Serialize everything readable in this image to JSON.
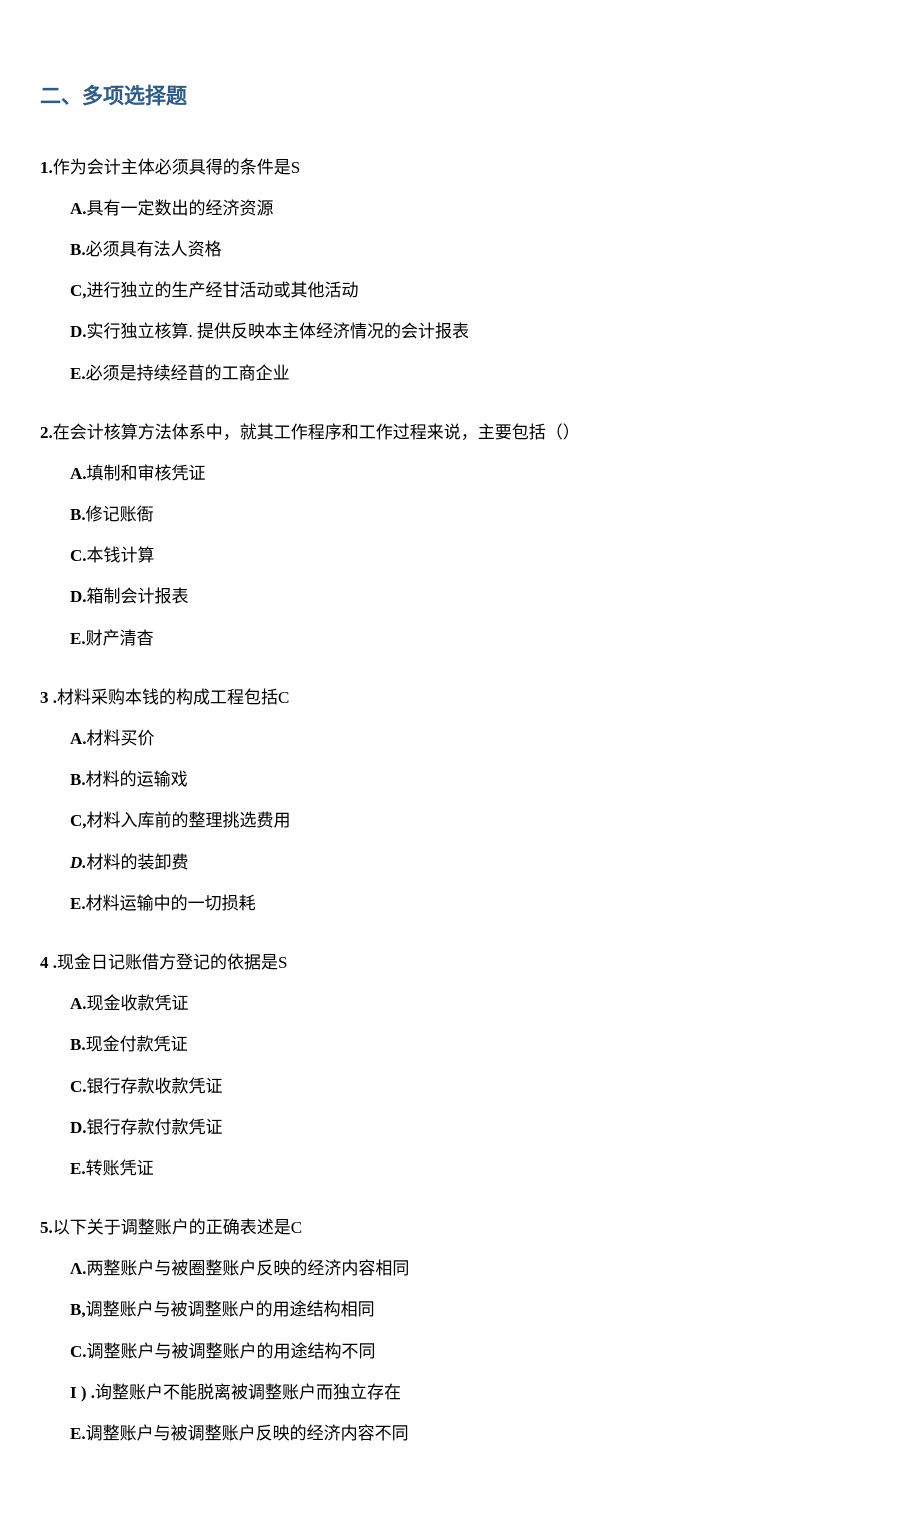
{
  "sectionTitle": "二、多项选择题",
  "questions": [
    {
      "number": "1.",
      "text": "作为会计主体必须具得的条件是S",
      "options": [
        {
          "label": "A.",
          "text": "具有一定数出的经济资源"
        },
        {
          "label": "B.",
          "text": "必须具有法人资格"
        },
        {
          "label": "C,",
          "text": "进行独立的生产经甘活动或其他活动"
        },
        {
          "label": "D.",
          "text": "实行独立核算. 提供反映本主体经济情况的会计报表"
        },
        {
          "label": "E.",
          "text": "必须是持续经苜的工商企业"
        }
      ]
    },
    {
      "number": "2.",
      "text": "在会计核算方法体系中，就其工作程序和工作过程来说，主要包括（）",
      "options": [
        {
          "label": "A.",
          "text": "填制和审核凭证"
        },
        {
          "label": "B.",
          "text": "修记账衙"
        },
        {
          "label": "C.",
          "text": "本钱计算"
        },
        {
          "label": "D.",
          "text": "箱制会计报表"
        },
        {
          "label": "E.",
          "text": "财产清杳"
        }
      ]
    },
    {
      "number": "3  .",
      "text": "材料采购本钱的构成工程包括C",
      "options": [
        {
          "label": "A.",
          "text": "材料买价"
        },
        {
          "label": "B.",
          "text": "材料的运输戏"
        },
        {
          "label": "C,",
          "text": "材料入库前的整理挑选费用"
        },
        {
          "label": "D.",
          "text": "材料的装卸费",
          "italic": true
        },
        {
          "label": "E.",
          "text": "材料运输中的一切损耗"
        }
      ]
    },
    {
      "number": "4  .",
      "text": "现金日记账借方登记的依据是S",
      "options": [
        {
          "label": "A.",
          "text": "现金收款凭证"
        },
        {
          "label": "B.",
          "text": "现金付款凭证"
        },
        {
          "label": "C.",
          "text": "银行存款收款凭证"
        },
        {
          "label": "D.",
          "text": "银行存款付款凭证"
        },
        {
          "label": "E.",
          "text": "转账凭证"
        }
      ]
    },
    {
      "number": "5.",
      "text": "以下关于调整账户的正确表述是C",
      "options": [
        {
          "label": "Λ.",
          "text": "两整账户与被圈整账户反映的经济内容相同"
        },
        {
          "label": "B,",
          "text": "调整账户与被调整账户的用途结构相同"
        },
        {
          "label": "C.",
          "text": "调整账户与被调整账户的用途结构不同"
        },
        {
          "label": "I ) .",
          "text": "询整账户不能脱离被调整账户而独立存在"
        },
        {
          "label": "E.",
          "text": "调整账户与被调整账户反映的经济内容不同"
        }
      ]
    }
  ]
}
